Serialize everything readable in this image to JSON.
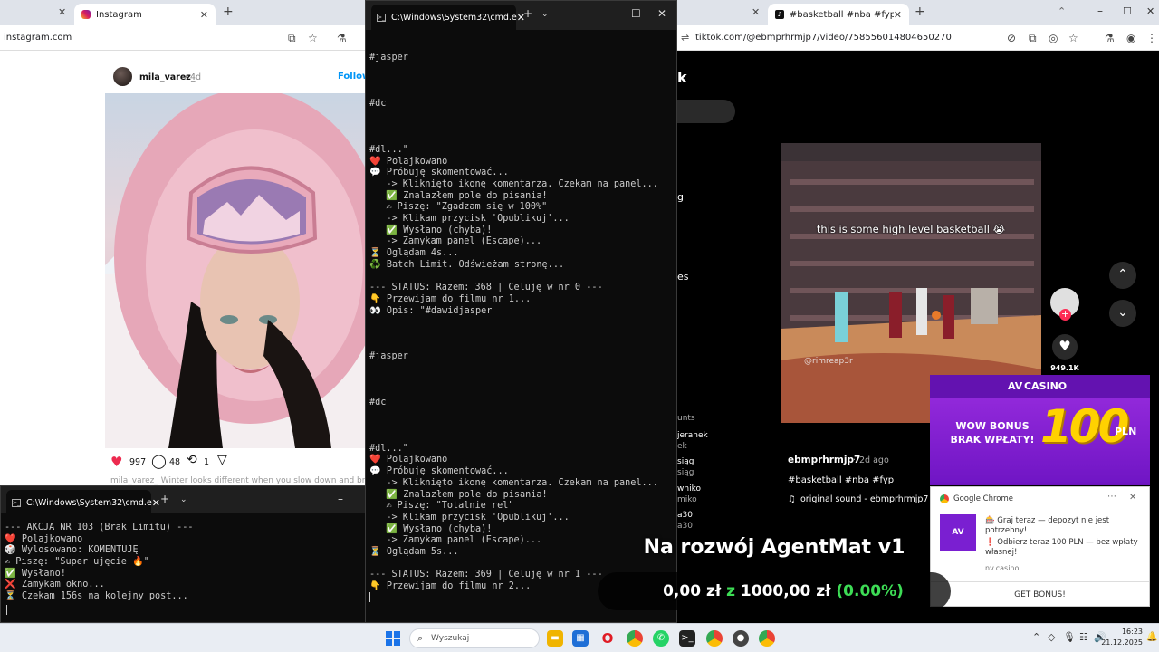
{
  "instagram_window": {
    "tab_title": "Instagram",
    "url": "instagram.com",
    "post": {
      "username": "mila_varez_",
      "age": "4d",
      "follow_label": "Follow",
      "likes": "997",
      "comments": "48",
      "reposts": "1",
      "caption_preview": "mila_varez_ Winter looks different when you slow down and breath"
    }
  },
  "terminal_main": {
    "title": "C:\\Windows\\System32\\cmd.e",
    "lines": [
      "",
      "",
      "#jasper",
      "",
      "",
      "",
      "#dc",
      "",
      "",
      "",
      "#dl...\"",
      "❤️ Polajkowano",
      "💬 Próbuję skomentować...",
      "   -> Kliknięto ikonę komentarza. Czekam na panel...",
      "   ✅ Znalazłem pole do pisania!",
      "   ✍ Piszę: \"Zgadzam się w 100%\"",
      "   -> Klikam przycisk 'Opublikuj'...",
      "   ✅ Wysłano (chyba)!",
      "   -> Zamykam panel (Escape)...",
      "⏳ Oglądam 4s...",
      "♻️ Batch Limit. Odświeżam stronę...",
      "",
      "--- STATUS: Razem: 368 | Celuję w nr 0 ---",
      "👇 Przewijam do filmu nr 1...",
      "👀 Opis: \"#dawidjasper",
      "",
      "",
      "",
      "#jasper",
      "",
      "",
      "",
      "#dc",
      "",
      "",
      "",
      "#dl...\"",
      "❤️ Polajkowano",
      "💬 Próbuję skomentować...",
      "   -> Kliknięto ikonę komentarza. Czekam na panel...",
      "   ✅ Znalazłem pole do pisania!",
      "   ✍ Piszę: \"Totalnie rel\"",
      "   -> Klikam przycisk 'Opublikuj'...",
      "   ✅ Wysłano (chyba)!",
      "   -> Zamykam panel (Escape)...",
      "⏳ Oglądam 5s...",
      "",
      "--- STATUS: Razem: 369 | Celuję w nr 1 ---",
      "👇 Przewijam do filmu nr 2..."
    ]
  },
  "terminal_small": {
    "title": "C:\\Windows\\System32\\cmd.e",
    "lines": [
      "--- AKCJA NR 103 (Brak Limitu) ---",
      "❤️ Polajkowano",
      "🎲 Wylosowano: KOMENTUJĘ",
      "✍ Piszę: \"Super ujęcie 🔥\"",
      "✅ Wysłano!",
      "❌ Zamykam okno...",
      "⏳ Czekam 156s na kolejny post..."
    ]
  },
  "tiktok_window": {
    "tab_title": "#basketball #nba #fyp | Tik",
    "url": "tiktok.com/@ebmprhrmjp7/video/758556014804650270",
    "video_caption": "this is some high level basketball 😭",
    "watermark": "@rimreap3r",
    "like_count": "949.1K",
    "author": "ebmprhrmjp7",
    "posted": "2d ago",
    "hashtags": "#basketball #nba #fyp",
    "sound": "original sound - ebmprhrmjp7",
    "left_fragments": [
      "k",
      "g",
      "es",
      "unts",
      "jeranek",
      "ek",
      "siąg",
      "siąg",
      "wniko",
      "miko",
      "a30",
      "a30"
    ]
  },
  "casino_ad": {
    "brand": "CASINO",
    "headline_line1": "WOW BONUS",
    "headline_line2": "BRAK WPŁATY!",
    "amount": "100",
    "currency": "PLN"
  },
  "chrome_notification": {
    "app": "Google Chrome",
    "line1": "🎰 Graj teraz — depozyt nie jest potrzebny!",
    "line2": "❗ Odbierz teraz 100 PLN — bez wpłaty własnej!",
    "site": "nv.casino",
    "button": "GET BONUS!"
  },
  "overlay": {
    "title": "Na rozwój AgentMat v1",
    "current": "0,00 zł",
    "z": "z",
    "goal": "1000,00 zł",
    "percent": "(0.00%)",
    "progress_fraction": 0.0
  },
  "taskbar": {
    "search_placeholder": "Wyszukaj",
    "time": "16:23",
    "date": "21.12.2025"
  },
  "colors": {
    "accent_green": "#3ddc55",
    "ad_purple": "#7a1fd1",
    "ad_gold": "#ffd200",
    "tiktok_red": "#fe2c55"
  }
}
